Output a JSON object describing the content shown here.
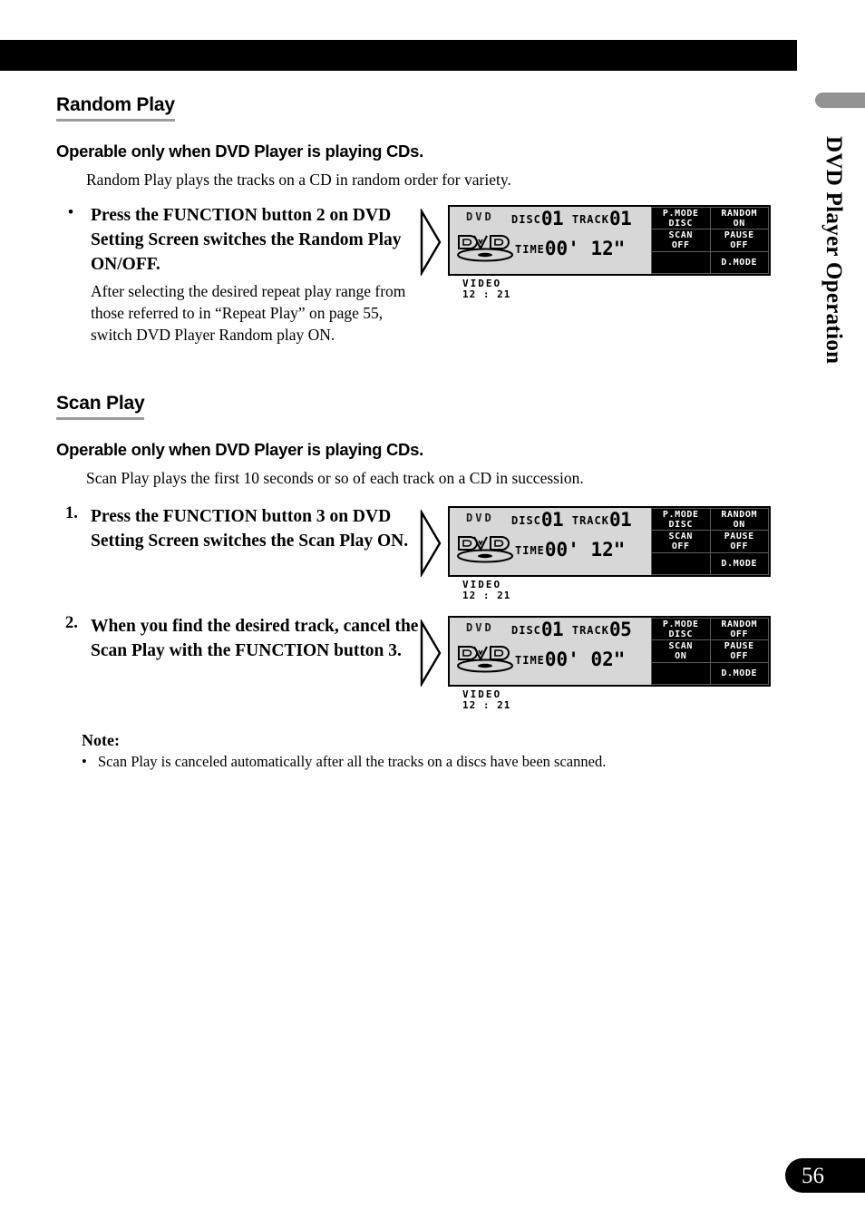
{
  "page": {
    "number": "56",
    "side_title": "DVD Player Operation"
  },
  "sections": [
    {
      "heading": "Random Play",
      "subheading": "Operable only when DVD Player is playing CDs.",
      "intro": "Random Play plays the tracks on a CD in random order for variety.",
      "steps": [
        {
          "marker": "•",
          "body": "Press the FUNCTION button 2 on DVD Setting Screen switches the Random Play ON/OFF.",
          "note": "After selecting the desired repeat play range from those referred to in “Repeat Play” on page 55, switch DVD Player Random play ON."
        }
      ]
    },
    {
      "heading": "Scan Play",
      "subheading": "Operable only when DVD Player is playing CDs.",
      "intro": "Scan Play plays the first 10 seconds or so of each track on a CD in succession.",
      "steps": [
        {
          "marker": "1.",
          "body": "Press the FUNCTION button 3 on DVD Setting Screen switches the Scan Play ON.",
          "note": ""
        },
        {
          "marker": "2.",
          "body": "When you find the desired track, cancel the Scan Play with the FUNCTION button 3.",
          "note": ""
        }
      ]
    }
  ],
  "displays": [
    {
      "source_tag": "DVD",
      "disc_label": "DISC",
      "disc_value": "01",
      "track_label": "TRACK",
      "track_value": "01",
      "time_label": "TIME",
      "time_value": "00' 12\"",
      "logo_text": "DVD",
      "logo_video": "VIDEO",
      "logo_clock": "12 : 21",
      "buttons": [
        {
          "line1": "P.MODE",
          "line2": "DISC"
        },
        {
          "line1": "RANDOM",
          "line2": "ON"
        },
        {
          "line1": "SCAN",
          "line2": "OFF"
        },
        {
          "line1": "PAUSE",
          "line2": "OFF"
        },
        {
          "line1": "",
          "line2": ""
        },
        {
          "line1": "D.MODE",
          "line2": ""
        }
      ]
    },
    {
      "source_tag": "DVD",
      "disc_label": "DISC",
      "disc_value": "01",
      "track_label": "TRACK",
      "track_value": "01",
      "time_label": "TIME",
      "time_value": "00' 12\"",
      "logo_text": "DVD",
      "logo_video": "VIDEO",
      "logo_clock": "12 : 21",
      "buttons": [
        {
          "line1": "P.MODE",
          "line2": "DISC"
        },
        {
          "line1": "RANDOM",
          "line2": "ON"
        },
        {
          "line1": "SCAN",
          "line2": "OFF"
        },
        {
          "line1": "PAUSE",
          "line2": "OFF"
        },
        {
          "line1": "",
          "line2": ""
        },
        {
          "line1": "D.MODE",
          "line2": ""
        }
      ]
    },
    {
      "source_tag": "DVD",
      "disc_label": "DISC",
      "disc_value": "01",
      "track_label": "TRACK",
      "track_value": "05",
      "time_label": "TIME",
      "time_value": "00' 02\"",
      "logo_text": "DVD",
      "logo_video": "VIDEO",
      "logo_clock": "12 : 21",
      "buttons": [
        {
          "line1": "P.MODE",
          "line2": "DISC"
        },
        {
          "line1": "RANDOM",
          "line2": "OFF"
        },
        {
          "line1": "SCAN",
          "line2": "ON"
        },
        {
          "line1": "PAUSE",
          "line2": "OFF"
        },
        {
          "line1": "",
          "line2": ""
        },
        {
          "line1": "D.MODE",
          "line2": ""
        }
      ]
    }
  ],
  "note": {
    "title": "Note:",
    "bullet": "•",
    "items": [
      "Scan Play is canceled automatically after all the tracks on a discs have been scanned."
    ]
  },
  "colors": {
    "header_bar": "#000000",
    "side_tab": "#939393",
    "heading_rule": "#9b9b9b",
    "lcd_background": "#d7d7d7",
    "lcd_panel": "#000000",
    "page_tab": "#000000"
  }
}
